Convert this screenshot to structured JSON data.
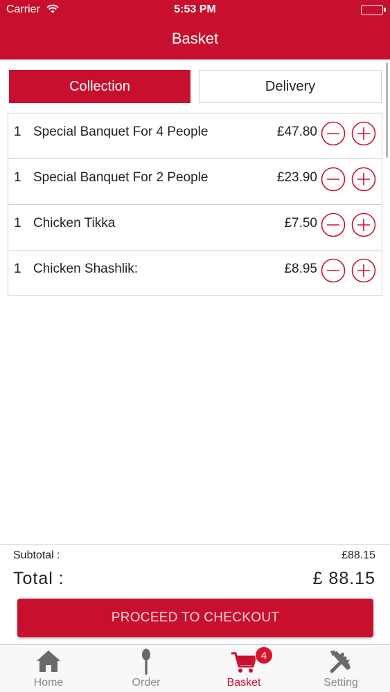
{
  "status_bar": {
    "carrier": "Carrier",
    "time": "5:53 PM"
  },
  "nav": {
    "title": "Basket"
  },
  "mode_tabs": {
    "collection": "Collection",
    "delivery": "Delivery",
    "selected": "collection"
  },
  "basket_items": [
    {
      "qty": "1",
      "name": "Special Banquet For 4 People",
      "price": "£47.80"
    },
    {
      "qty": "1",
      "name": "Special Banquet For 2 People",
      "price": "£23.90"
    },
    {
      "qty": "1",
      "name": "Chicken Tikka",
      "price": "£7.50"
    },
    {
      "qty": "1",
      "name": "Chicken Shashlik:",
      "price": "£8.95"
    }
  ],
  "summary": {
    "subtotal_label": "Subtotal :",
    "subtotal_value": "£88.15",
    "total_label": "Total :",
    "total_value": "£ 88.15",
    "checkout_label": "PROCEED TO CHECKOUT"
  },
  "tab_bar": {
    "tabs": [
      {
        "label": "Home",
        "icon": "home-icon"
      },
      {
        "label": "Order",
        "icon": "spoon-icon"
      },
      {
        "label": "Basket",
        "icon": "cart-icon",
        "badge": "4"
      },
      {
        "label": "Setting",
        "icon": "tools-icon"
      }
    ],
    "active": "Basket"
  },
  "colors": {
    "brand_red": "#c8102e",
    "inactive_gray": "#888888",
    "border_gray": "#cfcfcf"
  }
}
